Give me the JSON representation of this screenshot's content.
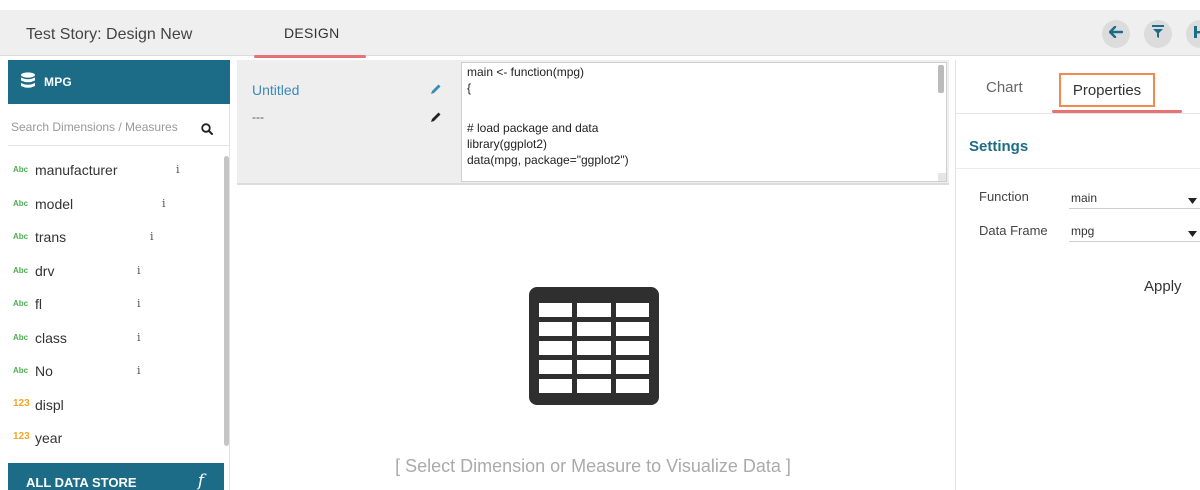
{
  "header": {
    "story_title": "Test Story: Design New",
    "tab_label": "DESIGN"
  },
  "sidebar": {
    "datastore_name": "MPG",
    "search_placeholder": "Search Dimensions / Measures",
    "fields": [
      {
        "type_badge": "Abc",
        "name": "manufacturer",
        "kind": "dimension",
        "info": "i"
      },
      {
        "type_badge": "Abc",
        "name": "model",
        "kind": "dimension",
        "info": "i"
      },
      {
        "type_badge": "Abc",
        "name": "trans",
        "kind": "dimension",
        "info": "i"
      },
      {
        "type_badge": "Abc",
        "name": "drv",
        "kind": "dimension",
        "info": "i"
      },
      {
        "type_badge": "Abc",
        "name": "fl",
        "kind": "dimension",
        "info": "i"
      },
      {
        "type_badge": "Abc",
        "name": "class",
        "kind": "dimension",
        "info": "i"
      },
      {
        "type_badge": "Abc",
        "name": "No",
        "kind": "dimension",
        "info": "i"
      },
      {
        "type_badge": "123",
        "name": "displ",
        "kind": "measure",
        "info": ""
      },
      {
        "type_badge": "123",
        "name": "year",
        "kind": "measure",
        "info": ""
      }
    ],
    "footer_label": "ALL DATA STORE",
    "footer_icon_text": "f",
    "colors": {
      "header_bg": "#1c6c88",
      "dimension_badge": "#4caf50",
      "measure_badge": "#f4a623"
    }
  },
  "script": {
    "name": "Untitled",
    "description": "---",
    "code_lines": [
      "main <- function(mpg)",
      "{",
      "",
      "# load package and data",
      "library(ggplot2)",
      "data(mpg, package=\"ggplot2\")"
    ]
  },
  "viz": {
    "placeholder_icon": "table-icon",
    "hint": "[ Select Dimension or Measure to Visualize Data ]"
  },
  "properties": {
    "tabs": [
      "Chart",
      "Properties"
    ],
    "active_tab": "Properties",
    "section_title": "Settings",
    "function_label": "Function",
    "function_value": "main",
    "dataframe_label": "Data Frame",
    "dataframe_value": "mpg",
    "apply_label": "Apply",
    "colors": {
      "accent": "#1c6c88",
      "active_tab_border": "#f08a50",
      "tab_underline": "#e57373"
    }
  }
}
